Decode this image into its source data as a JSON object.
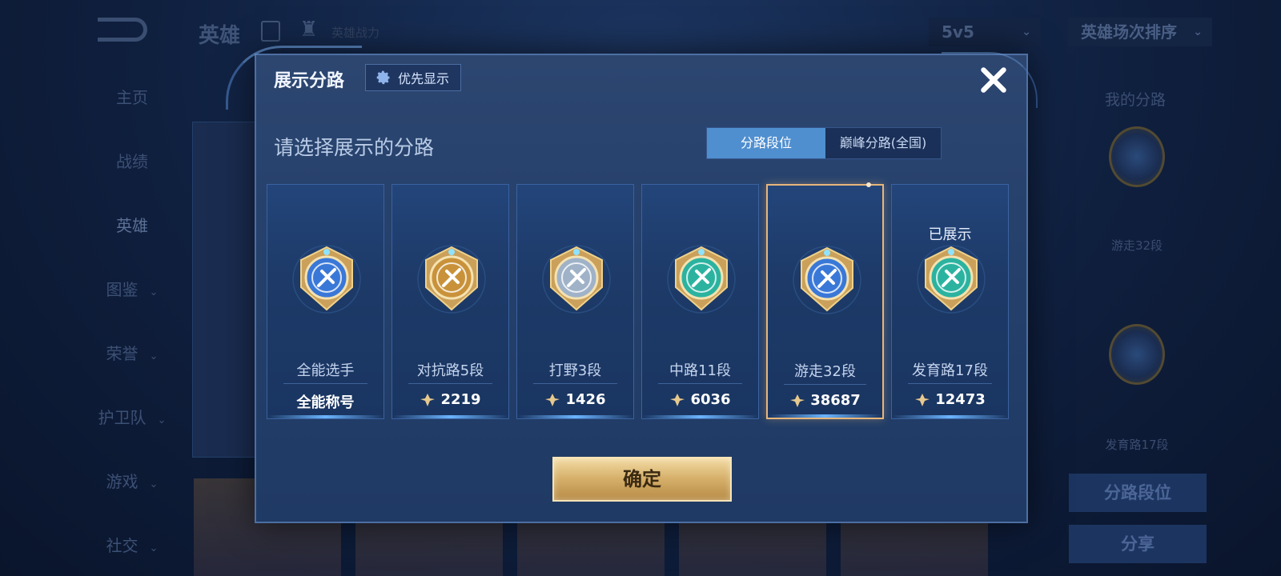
{
  "background": {
    "title": "英雄",
    "power_label": "英雄战力",
    "mode_select": "5v5",
    "sort_select": "英雄场次排序",
    "nav": [
      {
        "label": "主页",
        "has_chevron": false
      },
      {
        "label": "战绩",
        "has_chevron": false
      },
      {
        "label": "英雄",
        "has_chevron": false,
        "active": true
      },
      {
        "label": "图鉴",
        "has_chevron": true
      },
      {
        "label": "荣誉",
        "has_chevron": true
      },
      {
        "label": "护卫队",
        "has_chevron": true
      },
      {
        "label": "游戏",
        "has_chevron": true
      },
      {
        "label": "社交",
        "has_chevron": true
      }
    ],
    "side": {
      "title": "我的分路",
      "lane1": "游走32段",
      "lane2": "发育路17段",
      "btn_rank": "分路段位",
      "btn_share": "分享"
    }
  },
  "dialog": {
    "title": "展示分路",
    "priority_label": "优先显示",
    "subtitle": "请选择展示的分路",
    "tabs": [
      {
        "label": "分路段位",
        "active": true
      },
      {
        "label": "巅峰分路(全国)",
        "active": false
      }
    ],
    "cards": [
      {
        "name": "全能选手",
        "value": "全能称号",
        "show_icon": false,
        "status": "",
        "selected": false,
        "emblem": "allround-emblem",
        "color": "#3a78d8"
      },
      {
        "name": "对抗路5段",
        "value": "2219",
        "show_icon": true,
        "status": "",
        "selected": false,
        "emblem": "clash-lane-emblem",
        "color": "#c9923a"
      },
      {
        "name": "打野3段",
        "value": "1426",
        "show_icon": true,
        "status": "",
        "selected": false,
        "emblem": "jungle-emblem",
        "color": "#9fb2c8"
      },
      {
        "name": "中路11段",
        "value": "6036",
        "show_icon": true,
        "status": "",
        "selected": false,
        "emblem": "mid-lane-emblem",
        "color": "#2bb3a0"
      },
      {
        "name": "游走32段",
        "value": "38687",
        "show_icon": true,
        "status": "",
        "selected": true,
        "emblem": "roam-emblem",
        "color": "#3a78d8"
      },
      {
        "name": "发育路17段",
        "value": "12473",
        "show_icon": true,
        "status": "已展示",
        "selected": false,
        "emblem": "farm-lane-emblem",
        "color": "#2bb3a0"
      }
    ],
    "confirm_label": "确定"
  },
  "colors": {
    "accent_blue": "#4f8fd0",
    "gold": "#d8b36e",
    "selected_border": "#e8b67a"
  }
}
